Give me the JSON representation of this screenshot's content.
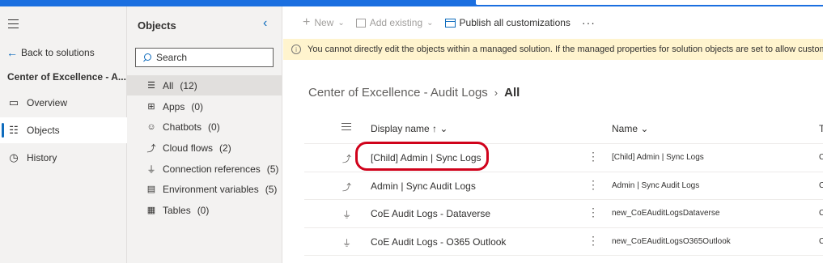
{
  "nav": {
    "back_label": "Back to solutions",
    "solution_title": "Center of Excellence - A...",
    "items": [
      {
        "label": "Overview",
        "icon": "overview-icon"
      },
      {
        "label": "Objects",
        "icon": "objects-icon",
        "selected": true
      },
      {
        "label": "History",
        "icon": "history-icon"
      }
    ]
  },
  "objects_panel": {
    "title": "Objects",
    "search_placeholder": "Search",
    "items": [
      {
        "label": "All",
        "count": "(12)",
        "selected": true
      },
      {
        "label": "Apps",
        "count": "(0)"
      },
      {
        "label": "Chatbots",
        "count": "(0)"
      },
      {
        "label": "Cloud flows",
        "count": "(2)"
      },
      {
        "label": "Connection references",
        "count": "(5)"
      },
      {
        "label": "Environment variables",
        "count": "(5)"
      },
      {
        "label": "Tables",
        "count": "(0)"
      }
    ]
  },
  "commands": {
    "new_label": "New",
    "add_existing_label": "Add existing",
    "publish_label": "Publish all customizations",
    "more_label": "···"
  },
  "warning": {
    "text": "You cannot directly edit the objects within a managed solution. If the managed properties for solution objects are set to allow customization, you can e"
  },
  "breadcrumb": {
    "parent": "Center of Excellence - Audit Logs",
    "separator": "›",
    "current": "All"
  },
  "table": {
    "col_display": "Display name ↑",
    "col_name": "Name",
    "col_type": "T",
    "rows": [
      {
        "display": "[Child] Admin | Sync Logs",
        "name": "[Child] Admin | Sync Logs",
        "type": "C",
        "kind": "flow"
      },
      {
        "display": "Admin | Sync Audit Logs",
        "name": "Admin | Sync Audit Logs",
        "type": "C",
        "kind": "flow"
      },
      {
        "display": "CoE Audit Logs - Dataverse",
        "name": "new_CoEAuditLogsDataverse",
        "type": "C",
        "kind": "connector"
      },
      {
        "display": "CoE Audit Logs - O365 Outlook",
        "name": "new_CoEAuditLogsO365Outlook",
        "type": "C",
        "kind": "connector"
      }
    ]
  },
  "colors": {
    "accent": "#0f6cbd",
    "topbar": "#1b6fe0",
    "warning_bg": "#fff4ce",
    "highlight": "#d0021b"
  }
}
